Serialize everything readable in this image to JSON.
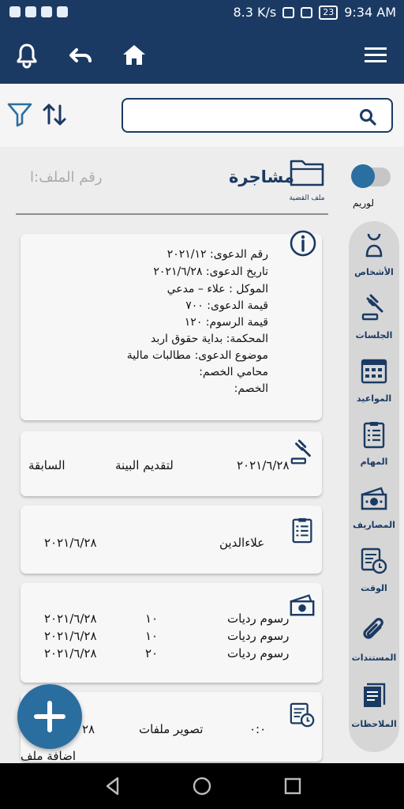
{
  "status": {
    "speed": "8.3 K/s",
    "battery": "23",
    "time": "9:34 AM"
  },
  "search": {
    "placeholder": ""
  },
  "header": {
    "file_number_label": "رقم الملف:ا",
    "case_type": "مشاجرة",
    "case_file_caption": "ملف القضية"
  },
  "toggle": {
    "label": "لوريم"
  },
  "sidebar": {
    "items": [
      {
        "label": "الأشخاص",
        "icon": "people-icon"
      },
      {
        "label": "الجلسات",
        "icon": "gavel-icon"
      },
      {
        "label": "المواعيد",
        "icon": "calendar-icon"
      },
      {
        "label": "المهام",
        "icon": "checklist-icon"
      },
      {
        "label": "المصاريف",
        "icon": "money-icon"
      },
      {
        "label": "الوقت",
        "icon": "timer-icon"
      },
      {
        "label": "المستندات",
        "icon": "paperclip-icon"
      },
      {
        "label": "الملاحظات",
        "icon": "note-icon"
      }
    ]
  },
  "details": {
    "lines": [
      "رقم الدعوى: ٢٠٢١/١٢",
      "تاريخ الدعوى: ٢٠٢١/٦/٢٨",
      "الموكل : علاء  – مدعي",
      "قيمة الدعوى: ٧٠٠",
      "قيمة الرسوم: ١٢٠",
      "المحكمة: بداية حقوق اربد",
      "موضوع الدعوى: مطالبات مالية",
      "محامي الخصم:",
      "الخصم:"
    ]
  },
  "session": {
    "date": "٢٠٢١/٦/٢٨",
    "purpose": "لتقديم البينة",
    "status": "السابقة"
  },
  "task": {
    "name": "علاءالدين",
    "date": "٢٠٢١/٦/٢٨"
  },
  "expenses": {
    "rows": [
      {
        "desc": "رسوم رديات",
        "amount": "١٠",
        "date": "٢٠٢١/٦/٢٨"
      },
      {
        "desc": "رسوم رديات",
        "amount": "١٠",
        "date": "٢٠٢١/٦/٢٨"
      },
      {
        "desc": "رسوم رديات",
        "amount": "٢٠",
        "date": "٢٠٢١/٦/٢٨"
      }
    ]
  },
  "time_entry": {
    "desc": "تصوير ملفات",
    "duration": "٠:٠",
    "date_partial": "٢٨"
  },
  "fab": {
    "label": "اضافة ملف"
  }
}
